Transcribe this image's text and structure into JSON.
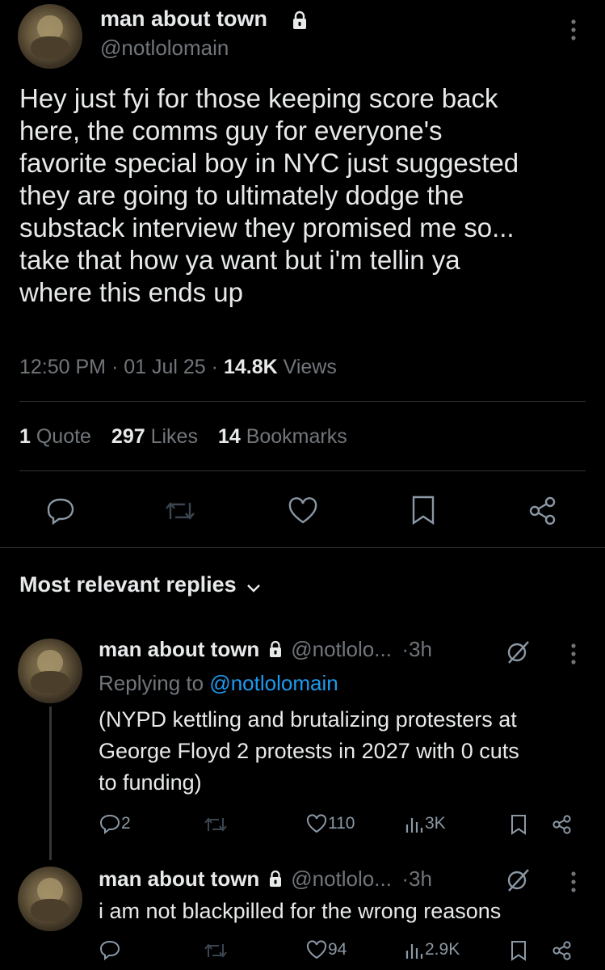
{
  "tweet": {
    "author_name": "man about town",
    "author_handle": "@notlolomain",
    "text_lines": [
      "Hey just fyi for those keeping score back",
      "here, the comms guy for everyone's",
      "favorite special boy in NYC just suggested",
      "they are going to ultimately dodge the",
      "substack interview they promised me so...",
      "take that how ya want but i'm tellin ya",
      "where this ends up"
    ],
    "time": "12:50 PM",
    "date": "01 Jul 25",
    "views_count": "14.8K",
    "views_label": "Views",
    "sep": "·",
    "quotes_count": "1",
    "quotes_label": "Quote",
    "likes_count": "297",
    "likes_label": "Likes",
    "bookmarks_count": "14",
    "bookmarks_label": "Bookmarks"
  },
  "replies_header": {
    "label": "Most relevant replies"
  },
  "replies": [
    {
      "author_name": "man about town",
      "author_handle": "@notlolo...",
      "time": "3h",
      "sep": "·",
      "replying_prefix": "Replying to",
      "replying_handle": "@notlolomain",
      "text_lines": [
        "(NYPD kettling and brutalizing protesters at",
        "George Floyd 2 protests in 2027 with 0 cuts",
        "to funding)"
      ],
      "replies_count": "2",
      "likes_count": "110",
      "views_count": "3K"
    },
    {
      "author_name": "man about town",
      "author_handle": "@notlolo...",
      "time": "3h",
      "sep": "·",
      "text_lines": [
        "i am not blackpilled for the wrong reasons"
      ],
      "replies_count": "",
      "likes_count": "94",
      "views_count": "2.9K"
    }
  ],
  "icons": {
    "lock": "lock-icon",
    "more": "more-vertical-icon",
    "reply": "reply-icon",
    "retweet": "retweet-icon",
    "like": "heart-icon",
    "bookmark": "bookmark-icon",
    "share": "share-icon",
    "chevron": "chevron-down-icon",
    "grok": "grok-icon",
    "views": "views-icon"
  },
  "colors": {
    "background": "#000000",
    "text": "#e7e9ea",
    "secondary": "#71767b",
    "link": "#1d9bf0",
    "divider": "#2f3336"
  }
}
